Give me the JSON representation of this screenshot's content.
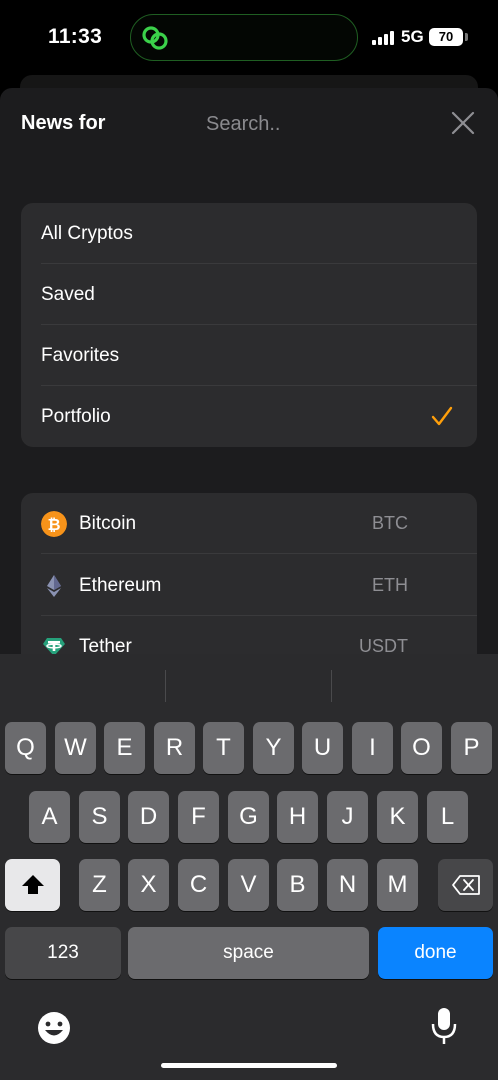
{
  "status_bar": {
    "time": "11:33",
    "network": "5G",
    "battery": "70"
  },
  "header": {
    "title": "News for",
    "search_placeholder": "Search..",
    "search_value": ""
  },
  "filters": [
    {
      "label": "All Cryptos",
      "selected": false
    },
    {
      "label": "Saved",
      "selected": false
    },
    {
      "label": "Favorites",
      "selected": false
    },
    {
      "label": "Portfolio",
      "selected": true
    }
  ],
  "coins": [
    {
      "name": "Bitcoin",
      "symbol": "BTC",
      "icon": "bitcoin-icon",
      "color": "#f7931a"
    },
    {
      "name": "Ethereum",
      "symbol": "ETH",
      "icon": "ethereum-icon",
      "color": "#8a92b2"
    },
    {
      "name": "Tether",
      "symbol": "USDT",
      "icon": "tether-icon",
      "color": "#26a17b"
    }
  ],
  "accent_color": "#ff9f0a",
  "keyboard": {
    "row1": [
      "Q",
      "W",
      "E",
      "R",
      "T",
      "Y",
      "U",
      "I",
      "O",
      "P"
    ],
    "row2": [
      "A",
      "S",
      "D",
      "F",
      "G",
      "H",
      "J",
      "K",
      "L"
    ],
    "row3": [
      "Z",
      "X",
      "C",
      "V",
      "B",
      "N",
      "M"
    ],
    "numbers_label": "123",
    "space_label": "space",
    "done_label": "done"
  }
}
